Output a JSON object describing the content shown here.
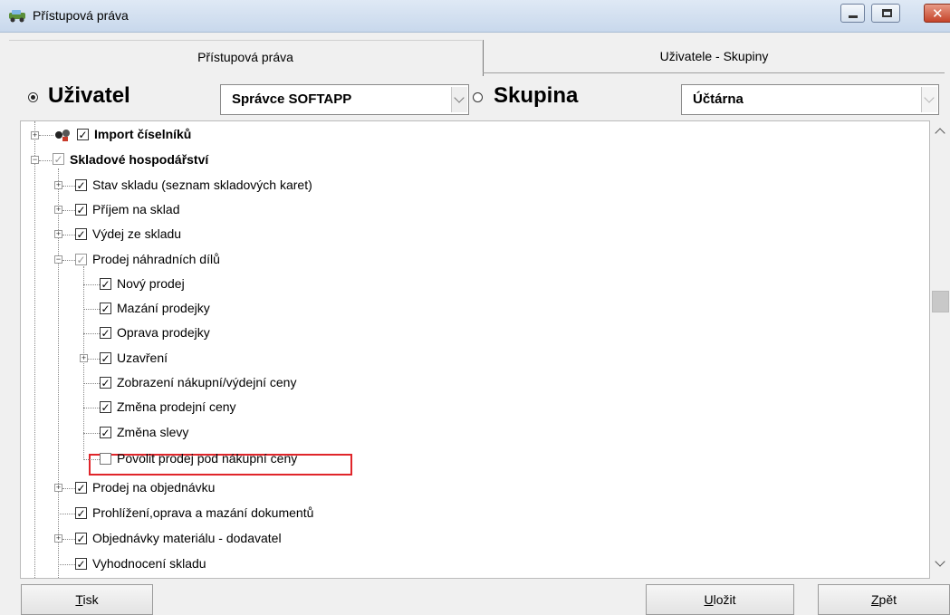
{
  "window": {
    "title": "Přístupová práva"
  },
  "tabs": [
    {
      "label": "Přístupová práva",
      "active": true
    },
    {
      "label": "Uživatele - Skupiny",
      "active": false
    }
  ],
  "selector": {
    "user_label": "Uživatel",
    "user_selected": true,
    "user_value": "Správce SOFTAPP",
    "group_label": "Skupina",
    "group_selected": false,
    "group_value": "Účtárna"
  },
  "tree": {
    "items": [
      {
        "label": "Import číselníků",
        "checked": true,
        "bold": true
      },
      {
        "label": "Skladové hospodářství",
        "checked": "partial",
        "bold": true
      },
      {
        "label": "Stav skladu (seznam skladových karet)",
        "checked": true
      },
      {
        "label": "Příjem na sklad",
        "checked": true
      },
      {
        "label": "Výdej ze skladu",
        "checked": true
      },
      {
        "label": "Prodej náhradních dílů",
        "checked": "partial"
      },
      {
        "label": "Nový prodej",
        "checked": true
      },
      {
        "label": "Mazání prodejky",
        "checked": true
      },
      {
        "label": "Oprava prodejky",
        "checked": true
      },
      {
        "label": "Uzavření",
        "checked": true
      },
      {
        "label": "Zobrazení nákupní/výdejní ceny",
        "checked": true
      },
      {
        "label": "Změna prodejní ceny",
        "checked": true
      },
      {
        "label": "Změna slevy",
        "checked": true
      },
      {
        "label": "Povolit prodej pod nákupní ceny",
        "checked": false,
        "highlighted": true
      },
      {
        "label": "Prodej na objednávku",
        "checked": true
      },
      {
        "label": "Prohlížení,oprava a mazání dokumentů",
        "checked": true
      },
      {
        "label": "Objednávky materiálu - dodavatel",
        "checked": true
      },
      {
        "label": "Vyhodnocení skladu",
        "checked": true
      }
    ]
  },
  "buttons": {
    "print": {
      "label": "Tisk",
      "accel": "T",
      "rest": "isk"
    },
    "save": {
      "label": "Uložit",
      "accel": "U",
      "rest": "ložit"
    },
    "back": {
      "label": "Zpět",
      "accel": "Z",
      "rest": "pět"
    }
  },
  "colors": {
    "highlight_border": "#e0252a",
    "check_gray": "#999999"
  }
}
